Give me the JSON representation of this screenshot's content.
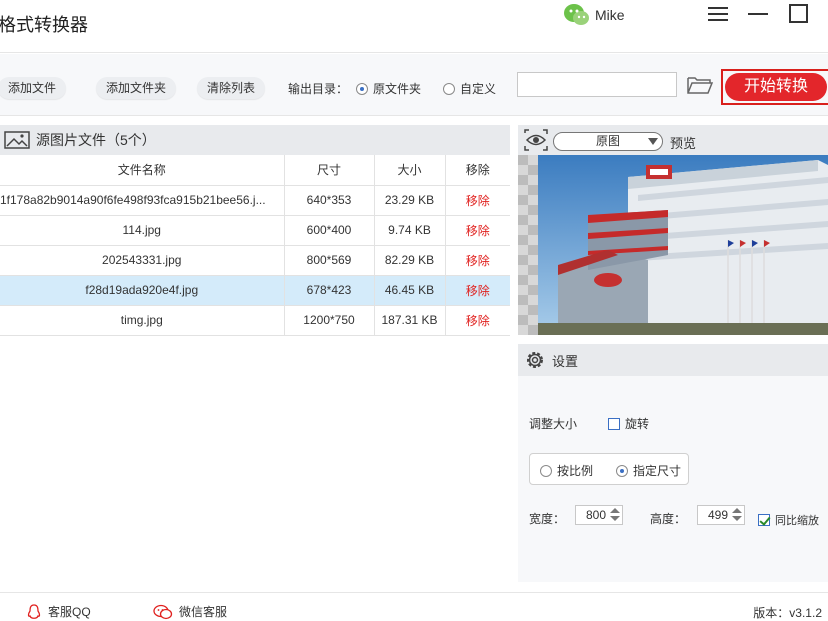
{
  "app": {
    "title": "格式转换器"
  },
  "user": {
    "name": "Mike"
  },
  "toolbar": {
    "add_file": "添加文件",
    "add_folder": "添加文件夹",
    "clear_list": "清除列表",
    "output_label": "输出目录：",
    "option_source": "原文件夹",
    "option_custom": "自定义",
    "selected_output": "原文件夹",
    "path_value": "",
    "start_button": "开始转换"
  },
  "file_panel": {
    "title": "源图片文件（5个）",
    "columns": [
      "文件名称",
      "尺寸",
      "大小",
      "移除"
    ],
    "rows": [
      {
        "name": "1f178a82b9014a90f6fe498f93fca915b21bee56.j...",
        "size": "640*353",
        "filesize": "23.29 KB",
        "action": "移除"
      },
      {
        "name": "114.jpg",
        "size": "600*400",
        "filesize": "9.74 KB",
        "action": "移除"
      },
      {
        "name": "202543331.jpg",
        "size": "800*569",
        "filesize": "82.29 KB",
        "action": "移除"
      },
      {
        "name": "f28d19ada920e4f.jpg",
        "size": "678*423",
        "filesize": "46.45 KB",
        "action": "移除"
      },
      {
        "name": "timg.jpg",
        "size": "1200*750",
        "filesize": "187.31 KB",
        "action": "移除"
      }
    ],
    "selected_row": 3
  },
  "preview": {
    "mode": "原图",
    "label": "预览"
  },
  "settings": {
    "title": "设置",
    "resize_label": "调整大小",
    "rotate_label": "旋转",
    "rotate_checked": false,
    "by_ratio": "按比例",
    "fixed_size": "指定尺寸",
    "selected_mode": "指定尺寸",
    "width_label": "宽度：",
    "width_value": "800",
    "height_label": "高度：",
    "height_value": "499",
    "keep_ratio_label": "同比缩放",
    "keep_ratio_checked": true
  },
  "footer": {
    "qq": "客服QQ",
    "wechat": "微信客服",
    "version": "版本：v3.1.2"
  },
  "colors": {
    "accent_red": "#e3262b",
    "selected_row": "#d4ebfa",
    "panel_header": "#e8eaed"
  }
}
